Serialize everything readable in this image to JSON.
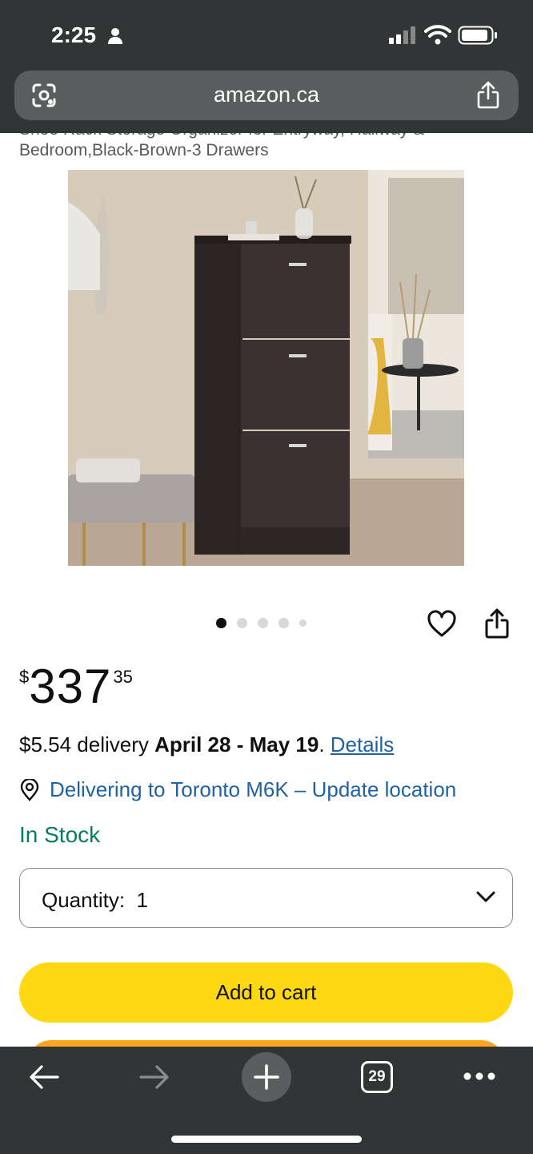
{
  "status_bar": {
    "time": "2:25"
  },
  "browser": {
    "url": "amazon.ca",
    "tab_count": "29"
  },
  "product": {
    "title_cut_line": "Shoe Rack Storage Organizer for Entryway, Hallway &",
    "title_line": "Bedroom,Black-Brown-3 Drawers",
    "image_index": 1,
    "image_count": 5
  },
  "price": {
    "symbol": "$",
    "whole": "337",
    "fraction": "35"
  },
  "delivery": {
    "cost": "$5.54 delivery ",
    "dates": "April 28 - May 19",
    "period": ". ",
    "details_link": "Details"
  },
  "location": {
    "text": "Delivering to Toronto M6K – Update location"
  },
  "stock": {
    "status": "In Stock",
    "color": "#067d62"
  },
  "quantity": {
    "label": "Quantity:  1"
  },
  "buttons": {
    "add_to_cart": "Add to cart",
    "add_to_cart_color": "#ffd814",
    "buy_now_color": "#ffa41c"
  }
}
